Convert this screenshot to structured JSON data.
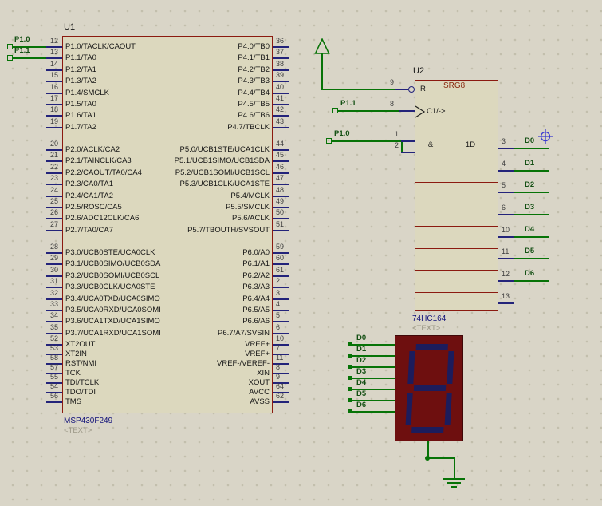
{
  "colors": {
    "bg": "#d9d5c7",
    "grid": "#c2beac",
    "body": "#dcd8be",
    "stroke": "#8b1a10",
    "pin": "#23237a",
    "wire": "#077307",
    "numc": "#3f3f3f",
    "namec": "#161616",
    "valuec": "#12127a",
    "phc": "#9b9786",
    "netc": "#145014",
    "srgc": "#8a2a10",
    "dispbg": "#6e0f0f",
    "segc": "#1c1c5c",
    "bluec": "#3a3ad0"
  },
  "u1": {
    "ref": "U1",
    "value": "MSP430F249",
    "placeholder": "<TEXT>",
    "left_groups": [
      {
        "pins": [
          {
            "num": "12",
            "name": "P1.0/TACLK/CAOUT"
          },
          {
            "num": "13",
            "name": "P1.1/TA0"
          },
          {
            "num": "14",
            "name": "P1.2/TA1"
          },
          {
            "num": "15",
            "name": "P1.3/TA2"
          },
          {
            "num": "16",
            "name": "P1.4/SMCLK"
          },
          {
            "num": "17",
            "name": "P1.5/TA0"
          },
          {
            "num": "18",
            "name": "P1.6/TA1"
          },
          {
            "num": "19",
            "name": "P1.7/TA2"
          }
        ]
      },
      {
        "pins": [
          {
            "num": "20",
            "name": "P2.0/ACLK/CA2"
          },
          {
            "num": "21",
            "name": "P2.1/TAINCLK/CA3"
          },
          {
            "num": "22",
            "name": "P2.2/CAOUT/TA0/CA4"
          },
          {
            "num": "23",
            "name": "P2.3/CA0/TA1"
          },
          {
            "num": "24",
            "name": "P2.4/CA1/TA2"
          },
          {
            "num": "25",
            "name": "P2.5/ROSC/CA5"
          },
          {
            "num": "26",
            "name": "P2.6/ADC12CLK/CA6"
          },
          {
            "num": "27",
            "name": "P2.7/TA0/CA7"
          }
        ]
      },
      {
        "pins": [
          {
            "num": "28",
            "name": "P3.0/UCB0STE/UCA0CLK"
          },
          {
            "num": "29",
            "name": "P3.1/UCB0SIMO/UCB0SDA"
          },
          {
            "num": "30",
            "name": "P3.2/UCB0SOMI/UCB0SCL"
          },
          {
            "num": "31",
            "name": "P3.3/UCB0CLK/UCA0STE"
          },
          {
            "num": "32",
            "name": "P3.4/UCA0TXD/UCA0SIMO"
          },
          {
            "num": "33",
            "name": "P3.5/UCA0RXD/UCA0SOMI"
          },
          {
            "num": "34",
            "name": "P3.6/UCA1TXD/UCA1SIMO"
          },
          {
            "num": "35",
            "name": "P3.7/UCA1RXD/UCA1SOMI"
          }
        ]
      },
      {
        "pins": [
          {
            "num": "52",
            "name": "XT2OUT"
          },
          {
            "num": "53",
            "name": "XT2IN"
          },
          {
            "num": "58",
            "name": "RST/NMI"
          },
          {
            "num": "57",
            "name": "TCK"
          },
          {
            "num": "55",
            "name": "TDI/TCLK"
          },
          {
            "num": "54",
            "name": "TDO/TDI"
          },
          {
            "num": "56",
            "name": "TMS"
          }
        ]
      }
    ],
    "right_groups": [
      {
        "pins": [
          {
            "num": "36",
            "name": "P4.0/TB0"
          },
          {
            "num": "37",
            "name": "P4.1/TB1"
          },
          {
            "num": "38",
            "name": "P4.2/TB2"
          },
          {
            "num": "39",
            "name": "P4.3/TB3"
          },
          {
            "num": "40",
            "name": "P4.4/TB4"
          },
          {
            "num": "41",
            "name": "P4.5/TB5"
          },
          {
            "num": "42",
            "name": "P4.6/TB6"
          },
          {
            "num": "43",
            "name": "P4.7/TBCLK"
          }
        ]
      },
      {
        "pins": [
          {
            "num": "44",
            "name": "P5.0/UCB1STE/UCA1CLK"
          },
          {
            "num": "45",
            "name": "P5.1/UCB1SIMO/UCB1SDA"
          },
          {
            "num": "46",
            "name": "P5.2/UCB1SOMI/UCB1SCL"
          },
          {
            "num": "47",
            "name": "P5.3/UCB1CLK/UCA1STE"
          },
          {
            "num": "48",
            "name": "P5.4/MCLK"
          },
          {
            "num": "49",
            "name": "P5.5/SMCLK"
          },
          {
            "num": "50",
            "name": "P5.6/ACLK"
          },
          {
            "num": "51",
            "name": "P5.7/TBOUTH/SVSOUT"
          }
        ]
      },
      {
        "pins": [
          {
            "num": "59",
            "name": "P6.0/A0"
          },
          {
            "num": "60",
            "name": "P6.1/A1"
          },
          {
            "num": "61",
            "name": "P6.2/A2"
          },
          {
            "num": "2",
            "name": "P6.3/A3"
          },
          {
            "num": "3",
            "name": "P6.4/A4"
          },
          {
            "num": "4",
            "name": "P6.5/A5"
          },
          {
            "num": "5",
            "name": "P6.6/A6"
          },
          {
            "num": "6",
            "name": "P6.7/A7/SVSIN"
          }
        ]
      },
      {
        "pins": [
          {
            "num": "10",
            "name": "VREF+"
          },
          {
            "num": "7",
            "name": "VREF+"
          },
          {
            "num": "11",
            "name": "VREF-/VEREF-"
          },
          {
            "num": "8",
            "name": "XIN"
          },
          {
            "num": "9",
            "name": "XOUT"
          },
          {
            "num": "64",
            "name": "AVCC"
          },
          {
            "num": "62",
            "name": "AVSS"
          }
        ]
      }
    ]
  },
  "u2": {
    "ref": "U2",
    "type_label": "SRG8",
    "value": "74HC164",
    "placeholder": "<TEXT>",
    "reset": {
      "num": "9",
      "name": "R"
    },
    "clock": {
      "num": "8",
      "name": "C1/->"
    },
    "inputs": [
      {
        "num": "1"
      },
      {
        "num": "2"
      }
    ],
    "cell_labels": {
      "and": "&",
      "d": "1D"
    },
    "outputs": [
      {
        "num": "3",
        "label": "D0"
      },
      {
        "num": "4",
        "label": "D1"
      },
      {
        "num": "5",
        "label": "D2"
      },
      {
        "num": "6",
        "label": "D3"
      },
      {
        "num": "10",
        "label": "D4"
      },
      {
        "num": "11",
        "label": "D5"
      },
      {
        "num": "12",
        "label": "D6"
      },
      {
        "num": "13",
        "label": ""
      }
    ]
  },
  "display": {
    "digit": "8",
    "inputs": [
      "D0",
      "D1",
      "D2",
      "D3",
      "D4",
      "D5",
      "D6"
    ],
    "segments_on": [
      "a",
      "b",
      "c",
      "d",
      "e",
      "f",
      "g"
    ]
  },
  "nets": {
    "u1_left": [
      "P1.0",
      "P1.1"
    ],
    "u2_clock": "P1.1",
    "u2_data": "P1.0"
  }
}
